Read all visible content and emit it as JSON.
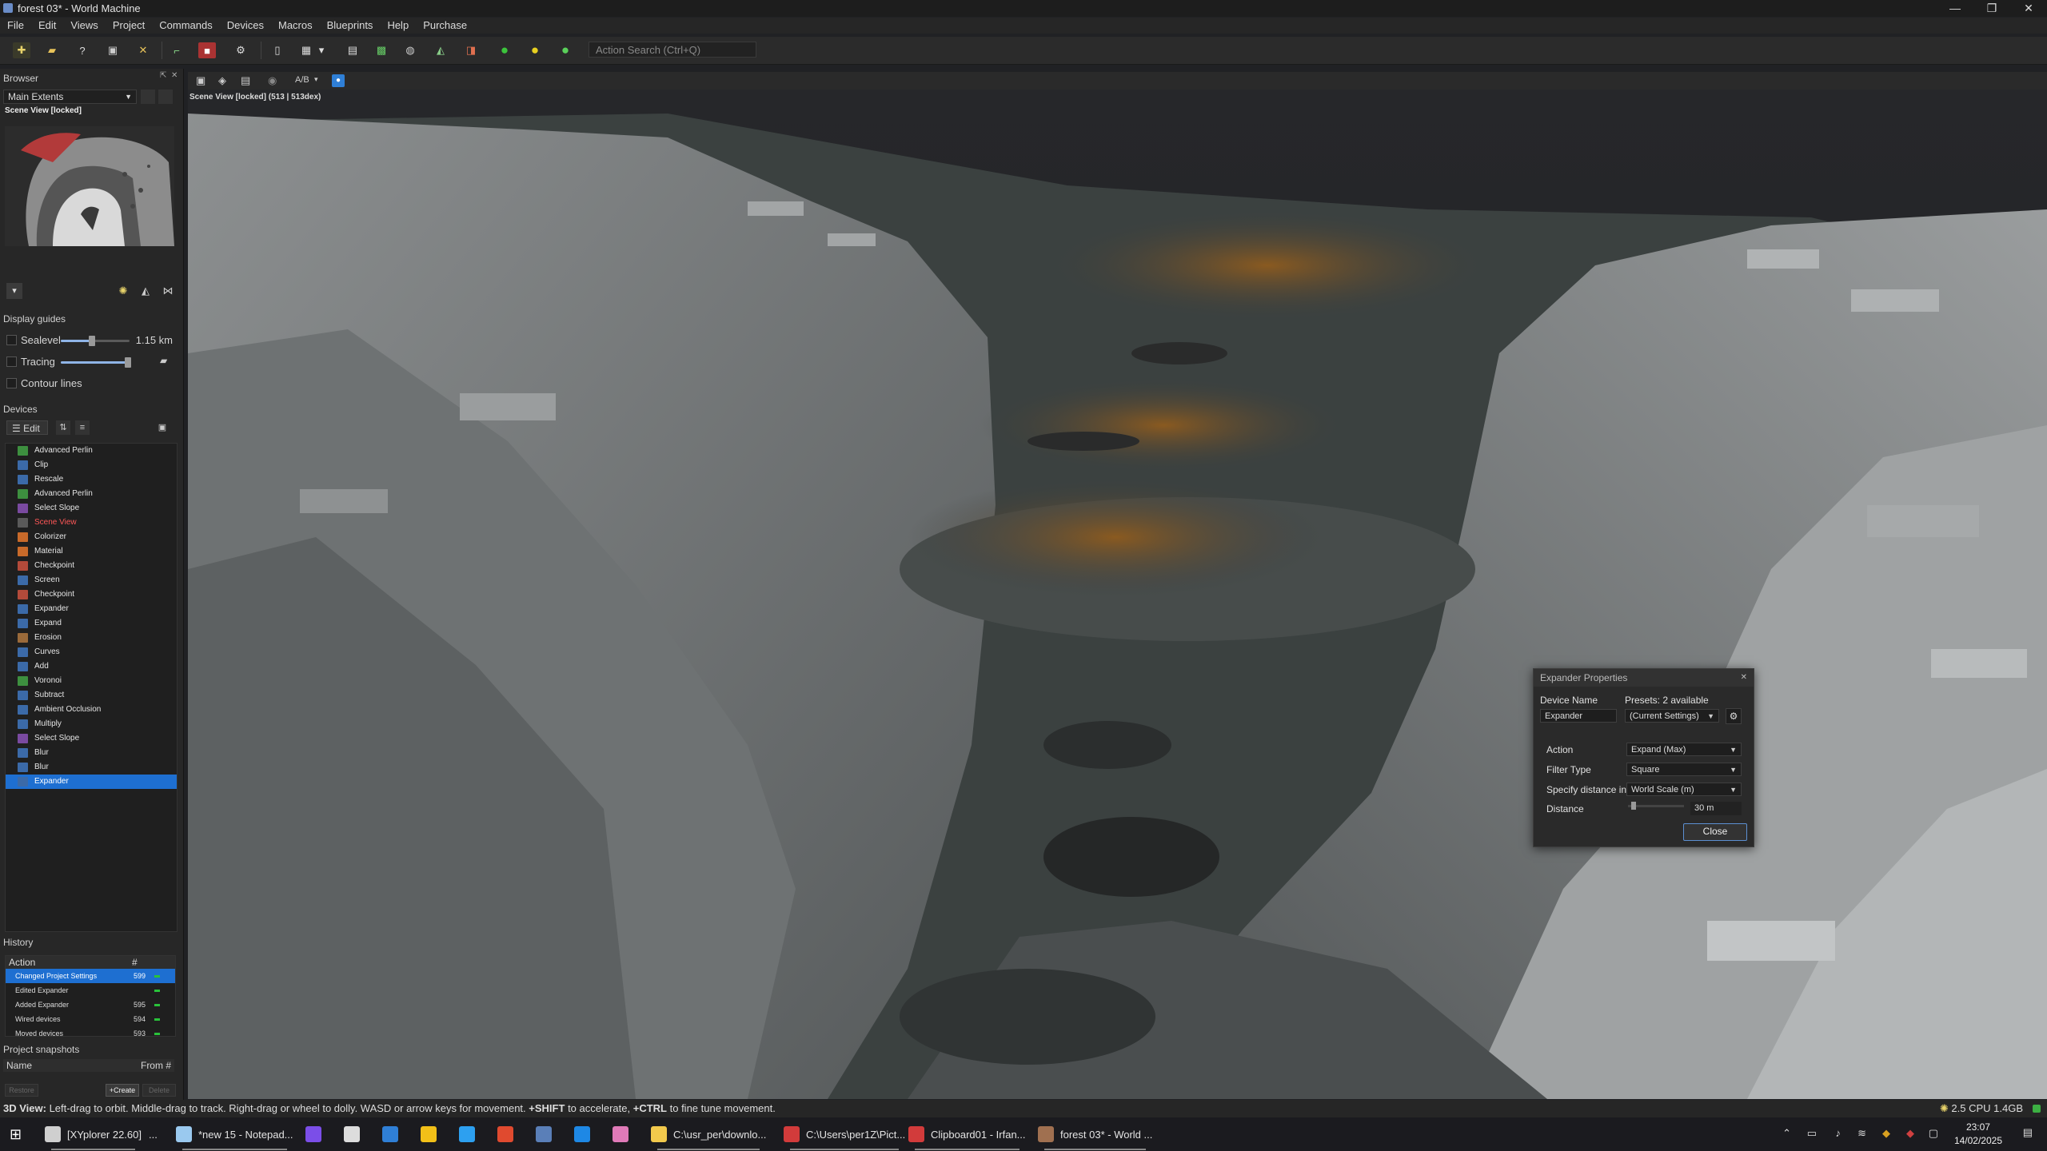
{
  "window": {
    "title": "forest 03* - World Machine",
    "controls": [
      "—",
      "❐",
      "✕"
    ]
  },
  "menu": [
    "File",
    "Edit",
    "Views",
    "Project",
    "Commands",
    "Devices",
    "Macros",
    "Blueprints",
    "Help",
    "Purchase"
  ],
  "toolbar": {
    "search_placeholder": "Action Search (Ctrl+Q)"
  },
  "browser": {
    "title": "Browser",
    "extents": "Main Extents",
    "view_label": "Scene View [locked]"
  },
  "display_guides": {
    "title": "Display guides",
    "sealevel_label": "Sealevel",
    "sealevel_value": "1.15 km",
    "sealevel_level": 0.45,
    "tracing_label": "Tracing",
    "tracing_level": 0.95,
    "contour_label": "Contour lines"
  },
  "devices": {
    "title": "Devices",
    "edit_label": "Edit",
    "items": [
      {
        "label": "Advanced Perlin",
        "color": "#3d8f3f"
      },
      {
        "label": "Clip",
        "color": "#3b6aa8"
      },
      {
        "label": "Rescale",
        "color": "#3b6aa8"
      },
      {
        "label": "Advanced Perlin",
        "color": "#3d8f3f"
      },
      {
        "label": "Select Slope",
        "color": "#7a4aa0"
      },
      {
        "label": "Scene View",
        "color": "#5a5a5a"
      },
      {
        "label": "Colorizer",
        "color": "#c86a2a"
      },
      {
        "label": "Material",
        "color": "#c86a2a"
      },
      {
        "label": "Checkpoint",
        "color": "#b34a3a"
      },
      {
        "label": "Screen",
        "color": "#3b6aa8"
      },
      {
        "label": "Checkpoint",
        "color": "#b34a3a"
      },
      {
        "label": "Expander",
        "color": "#3b6aa8"
      },
      {
        "label": "Expand",
        "color": "#3b6aa8"
      },
      {
        "label": "Erosion",
        "color": "#9a6a3a"
      },
      {
        "label": "Curves",
        "color": "#3b6aa8"
      },
      {
        "label": "Add",
        "color": "#3b6aa8"
      },
      {
        "label": "Voronoi",
        "color": "#3d8f3f"
      },
      {
        "label": "Subtract",
        "color": "#3b6aa8"
      },
      {
        "label": "Ambient Occlusion",
        "color": "#3b6aa8"
      },
      {
        "label": "Multiply",
        "color": "#3b6aa8"
      },
      {
        "label": "Select Slope",
        "color": "#7a4aa0"
      },
      {
        "label": "Blur",
        "color": "#3b6aa8"
      },
      {
        "label": "Blur",
        "color": "#3b6aa8"
      },
      {
        "label": "Expander",
        "color": "#3b6aa8"
      }
    ]
  },
  "history": {
    "title": "History",
    "col_action": "Action",
    "col_num": "#",
    "rows": [
      {
        "action": "Changed Project Settings",
        "num": "599"
      },
      {
        "action": "Edited Expander",
        "num": ""
      },
      {
        "action": "Added Expander",
        "num": "595"
      },
      {
        "action": "Wired devices",
        "num": "594"
      },
      {
        "action": "Moved devices",
        "num": "593"
      }
    ]
  },
  "snapshots": {
    "title": "Project snapshots",
    "col_name": "Name",
    "col_from": "From #",
    "restore": "Restore",
    "create": "+Create",
    "delete": "Delete"
  },
  "viewport": {
    "label": "Scene View [locked] (513 | 513dex)",
    "ab_label": "A/B"
  },
  "expander_props": {
    "title": "Expander Properties",
    "device_name_label": "Device Name",
    "device_name_value": "Expander",
    "presets_label": "Presets: 2 available",
    "presets_value": "(Current Settings)",
    "action_label": "Action",
    "action_value": "Expand (Max)",
    "filter_label": "Filter Type",
    "filter_value": "Square",
    "specify_label": "Specify distance in",
    "specify_value": "World Scale (m)",
    "distance_label": "Distance",
    "distance_value": "30 m",
    "close_label": "Close"
  },
  "status": {
    "prefix": "3D View:",
    "text": "Left-drag to orbit. Middle-drag to track. Right-drag or wheel to dolly. WASD or arrow keys for movement.",
    "shift": "+SHIFT",
    "shift_text": "to accelerate,",
    "ctrl": "+CTRL",
    "ctrl_text": "to fine tune movement.",
    "perf": "2.5 CPU 1.4GB"
  },
  "taskbar": {
    "items": [
      {
        "label": "[XYplorer 22.60]",
        "color": "#cfcfcf"
      },
      {
        "label": "...",
        "color": ""
      },
      {
        "label": "*new 15 - Notepad...",
        "color": "#9ac9ef"
      },
      {
        "label": "",
        "color": "#7b4ee8"
      },
      {
        "label": "",
        "color": "#dddddd"
      },
      {
        "label": "",
        "color": "#2f7fd6"
      },
      {
        "label": "",
        "color": "#f2c018"
      },
      {
        "label": "",
        "color": "#2da0f0"
      },
      {
        "label": "",
        "color": "#e04a2f"
      },
      {
        "label": "",
        "color": "#5a7fb8"
      },
      {
        "label": "",
        "color": "#1e88e5"
      },
      {
        "label": "",
        "color": "#e07ab8"
      },
      {
        "label": "C:\\usr_per\\downlo...",
        "color": "#f2c94c"
      },
      {
        "label": "C:\\Users\\per1Z\\Pict...",
        "color": "#d23b3b"
      },
      {
        "label": "Clipboard01 - Irfan...",
        "color": "#d23b3b"
      },
      {
        "label": "forest 03* - World ...",
        "color": "#a07050"
      }
    ],
    "time": "23:07",
    "date": "14/02/2025"
  }
}
